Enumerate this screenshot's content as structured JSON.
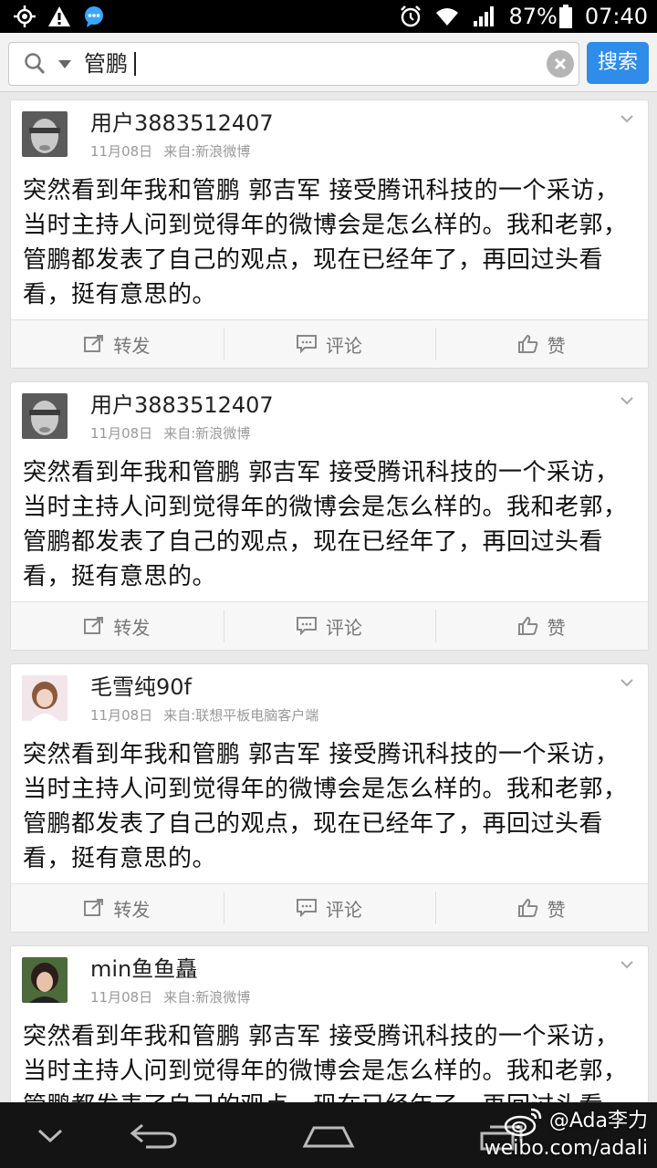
{
  "status_bar": {
    "battery": "87%",
    "time": "07:40"
  },
  "search": {
    "query": "管鹏",
    "button_label": "搜索"
  },
  "posts": [
    {
      "username": "用户3883512407",
      "date": "11月08日",
      "source": "来自:新浪微博",
      "text": "突然看到年我和管鹏 郭吉军 接受腾讯科技的一个采访，当时主持人问到觉得年的微博会是怎么样的。我和老郭，管鹏都发表了自己的观点，现在已经年了，再回过头看看，挺有意思的。",
      "repost_label": "转发",
      "comment_label": "评论",
      "like_label": "赞"
    },
    {
      "username": "用户3883512407",
      "date": "11月08日",
      "source": "来自:新浪微博",
      "text": "突然看到年我和管鹏 郭吉军 接受腾讯科技的一个采访，当时主持人问到觉得年的微博会是怎么样的。我和老郭，管鹏都发表了自己的观点，现在已经年了，再回过头看看，挺有意思的。",
      "repost_label": "转发",
      "comment_label": "评论",
      "like_label": "赞"
    },
    {
      "username": "毛雪纯90f",
      "date": "11月08日",
      "source": "来自:联想平板电脑客户端",
      "text": "突然看到年我和管鹏 郭吉军 接受腾讯科技的一个采访，当时主持人问到觉得年的微博会是怎么样的。我和老郭，管鹏都发表了自己的观点，现在已经年了，再回过头看看，挺有意思的。",
      "repost_label": "转发",
      "comment_label": "评论",
      "like_label": "赞"
    },
    {
      "username": "min鱼鱼矗",
      "date": "11月08日",
      "source": "来自:新浪微博",
      "text": "突然看到年我和管鹏 郭吉军 接受腾讯科技的一个采访，当时主持人问到觉得年的微博会是怎么样的。我和老郭，管鹏都发表了自己的观点，现在已经年了，再回过头看看，挺有意思的。"
    }
  ],
  "watermark": {
    "handle": "@Ada李力",
    "url": "weibo.com/adali"
  },
  "colors": {
    "accent": "#2f8ce8",
    "status_bar": "#000000",
    "nav_bar": "#141414",
    "feed_background": "#e9e9e9"
  }
}
